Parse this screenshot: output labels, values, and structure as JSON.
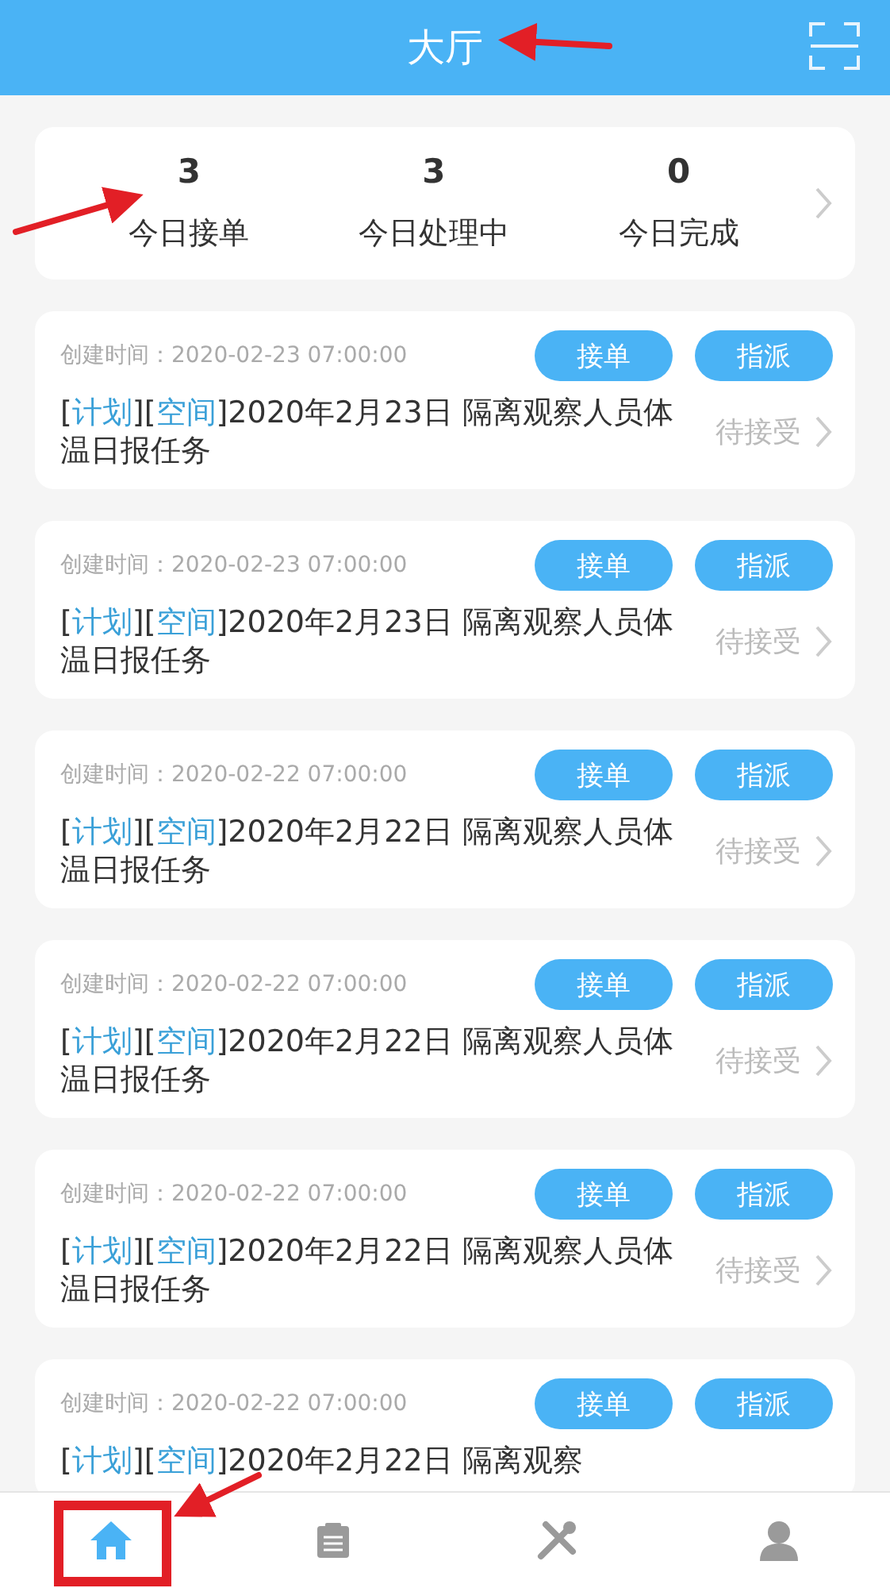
{
  "header": {
    "title": "大厅"
  },
  "stats": [
    {
      "value": "3",
      "label": "今日接单"
    },
    {
      "value": "3",
      "label": "今日处理中"
    },
    {
      "value": "0",
      "label": "今日完成"
    }
  ],
  "tasks": [
    {
      "created": "创建时间：2020-02-23 07:00:00",
      "buttons": [
        "接单",
        "指派"
      ],
      "title": [
        {
          "kind": "plain",
          "text": "["
        },
        {
          "kind": "tag",
          "text": "计划"
        },
        {
          "kind": "plain",
          "text": "]["
        },
        {
          "kind": "tag",
          "text": "空间"
        },
        {
          "kind": "plain",
          "text": "]2020年2月23日 隔离观察人员体温日报任务"
        }
      ],
      "status": "待接受"
    },
    {
      "created": "创建时间：2020-02-23 07:00:00",
      "buttons": [
        "接单",
        "指派"
      ],
      "title": [
        {
          "kind": "plain",
          "text": "["
        },
        {
          "kind": "tag",
          "text": "计划"
        },
        {
          "kind": "plain",
          "text": "]["
        },
        {
          "kind": "tag",
          "text": "空间"
        },
        {
          "kind": "plain",
          "text": "]2020年2月23日 隔离观察人员体温日报任务"
        }
      ],
      "status": "待接受"
    },
    {
      "created": "创建时间：2020-02-22 07:00:00",
      "buttons": [
        "接单",
        "指派"
      ],
      "title": [
        {
          "kind": "plain",
          "text": "["
        },
        {
          "kind": "tag",
          "text": "计划"
        },
        {
          "kind": "plain",
          "text": "]["
        },
        {
          "kind": "tag",
          "text": "空间"
        },
        {
          "kind": "plain",
          "text": "]2020年2月22日 隔离观察人员体温日报任务"
        }
      ],
      "status": "待接受"
    },
    {
      "created": "创建时间：2020-02-22 07:00:00",
      "buttons": [
        "接单",
        "指派"
      ],
      "title": [
        {
          "kind": "plain",
          "text": "["
        },
        {
          "kind": "tag",
          "text": "计划"
        },
        {
          "kind": "plain",
          "text": "]["
        },
        {
          "kind": "tag",
          "text": "空间"
        },
        {
          "kind": "plain",
          "text": "]2020年2月22日 隔离观察人员体温日报任务"
        }
      ],
      "status": "待接受"
    },
    {
      "created": "创建时间：2020-02-22 07:00:00",
      "buttons": [
        "接单",
        "指派"
      ],
      "title": [
        {
          "kind": "plain",
          "text": "["
        },
        {
          "kind": "tag",
          "text": "计划"
        },
        {
          "kind": "plain",
          "text": "]["
        },
        {
          "kind": "tag",
          "text": "空间"
        },
        {
          "kind": "plain",
          "text": "]2020年2月22日 隔离观察人员体温日报任务"
        }
      ],
      "status": "待接受"
    },
    {
      "created": "创建时间：2020-02-22 07:00:00",
      "buttons": [
        "接单",
        "指派"
      ],
      "title": [
        {
          "kind": "plain",
          "text": "["
        },
        {
          "kind": "tag",
          "text": "计划"
        },
        {
          "kind": "plain",
          "text": "]["
        },
        {
          "kind": "tag",
          "text": "空间"
        },
        {
          "kind": "plain",
          "text": "]2020年2月22日 隔离观察"
        }
      ]
    }
  ],
  "tabbar": [
    {
      "kind": "home",
      "selected": true
    },
    {
      "kind": "clipboard",
      "selected": false
    },
    {
      "kind": "tools",
      "selected": false
    },
    {
      "kind": "user",
      "selected": false
    }
  ]
}
